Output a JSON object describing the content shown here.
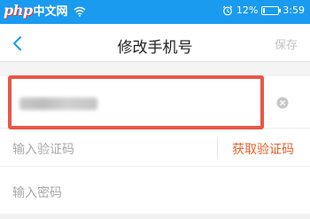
{
  "status_bar": {
    "logo_text": "php",
    "site_text": "中文网",
    "alarm_icon": "alarm-clock-icon",
    "battery_percent": "12%",
    "battery_level": 0.12,
    "time": "3:59"
  },
  "nav": {
    "back_icon": "chevron-left-icon",
    "title": "修改手机号",
    "save_label": "保存"
  },
  "form": {
    "phone_value": "",
    "clear_icon": "clear-circle-icon",
    "code_placeholder": "输入验证码",
    "get_code_label": "获取验证码",
    "password_placeholder": "输入密码"
  },
  "colors": {
    "status_bar_bg": "#1a9bf0",
    "accent_blue": "#1a9bf0",
    "highlight_red": "#ea5548",
    "get_code_orange": "#e8612b",
    "placeholder_gray": "#a9a9a9",
    "save_disabled_gray": "#c2c2c2"
  }
}
